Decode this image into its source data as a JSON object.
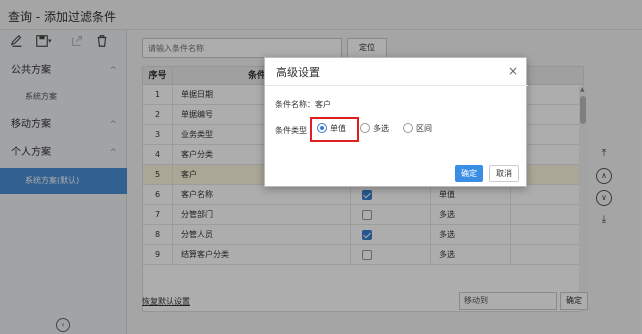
{
  "window": {
    "title": "查询 - 添加过滤条件"
  },
  "sidebar": {
    "groups": [
      {
        "label": "公共方案",
        "chevron": "^"
      },
      {
        "label": "移动方案",
        "chevron": "^"
      },
      {
        "label": "个人方案",
        "chevron": "^"
      }
    ],
    "items": [
      {
        "label": "系统方案"
      },
      {
        "label": "系统方案(默认)"
      }
    ],
    "collapse_icon": "‹"
  },
  "search": {
    "placeholder": "请输入条件名称",
    "locate_label": "定位"
  },
  "table": {
    "headers": [
      "序号",
      "条件名"
    ],
    "rows": [
      {
        "no": "1",
        "name": "单据日期",
        "checked": false,
        "type": ""
      },
      {
        "no": "2",
        "name": "单据编号",
        "checked": false,
        "type": ""
      },
      {
        "no": "3",
        "name": "业务类型",
        "checked": false,
        "type": ""
      },
      {
        "no": "4",
        "name": "客户分类",
        "checked": false,
        "type": ""
      },
      {
        "no": "5",
        "name": "客户",
        "checked": true,
        "type": ""
      },
      {
        "no": "6",
        "name": "客户名称",
        "checked": true,
        "type": "单值"
      },
      {
        "no": "7",
        "name": "分管部门",
        "checked": false,
        "type": "多选"
      },
      {
        "no": "8",
        "name": "分管人员",
        "checked": true,
        "type": "多选"
      },
      {
        "no": "9",
        "name": "结算客户分类",
        "checked": false,
        "type": "多选"
      }
    ],
    "selected_row": 4
  },
  "footer": {
    "restore_label": "恢复默认设置",
    "moveto_value": "移动到",
    "ok_label": "确定"
  },
  "dialog": {
    "title": "高级设置",
    "close_icon": "×",
    "name_label": "条件名称：",
    "name_value": "客户",
    "type_label": "条件类型",
    "options": [
      "单值",
      "多选",
      "区间"
    ],
    "selected_option": 0,
    "ok_label": "确定",
    "cancel_label": "取消"
  },
  "colors": {
    "accent": "#3a8ee6",
    "highlight": "#e02020",
    "selected_row": "#fbf6dd",
    "active_item": "#4a8ed6"
  }
}
